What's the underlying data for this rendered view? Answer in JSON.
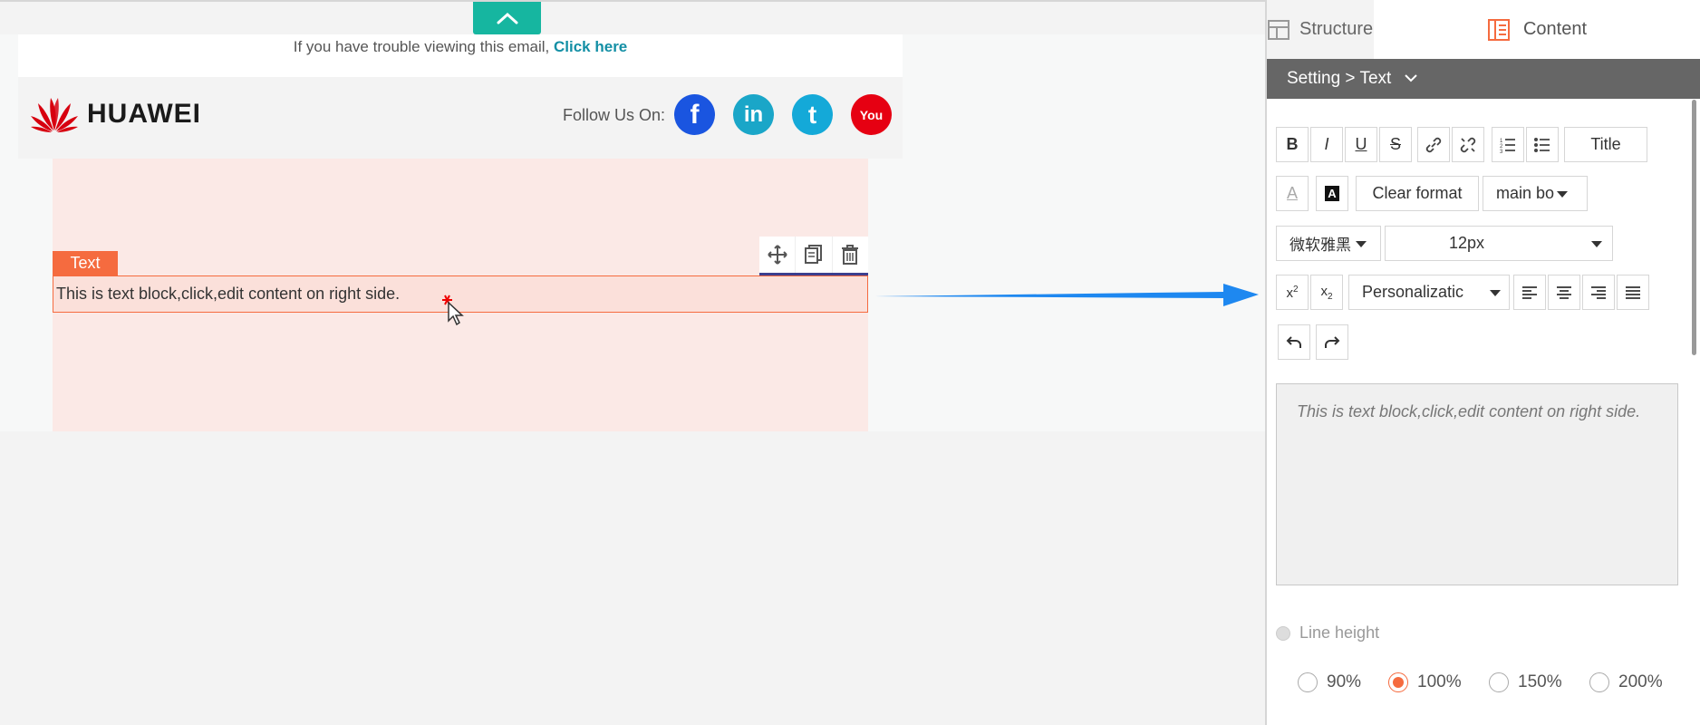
{
  "email": {
    "preheader_text": "If you have trouble viewing this email,",
    "preheader_link": "Click here",
    "brand": "HUAWEI",
    "follow_label": "Follow Us On:",
    "social": [
      "f",
      "in",
      "t",
      "You"
    ],
    "text_tag": "Text",
    "text_block": "This is text block,click,edit content on right side."
  },
  "panel": {
    "tab_structure": "Structure",
    "tab_content": "Content",
    "breadcrumb": "Setting > Text",
    "toolbar": {
      "bold": "B",
      "italic": "I",
      "underline": "U",
      "strike": "S",
      "title": "Title",
      "bgcolor_glyph": "A",
      "clear_format": "Clear format",
      "main_bo": "main bo",
      "font_family": "微软雅黑",
      "font_size": "12px",
      "personalization": "Personalizatic"
    },
    "editor_text": "This is text block,click,edit content on right side.",
    "line_height_label": "Line height",
    "line_height_options": [
      "90%",
      "100%",
      "150%",
      "200%"
    ],
    "line_height_selected": "100%"
  },
  "colors": {
    "accent": "#f56b3f",
    "teal": "#16b6a0",
    "link": "#138fa5",
    "arrow": "#1e88f0"
  }
}
